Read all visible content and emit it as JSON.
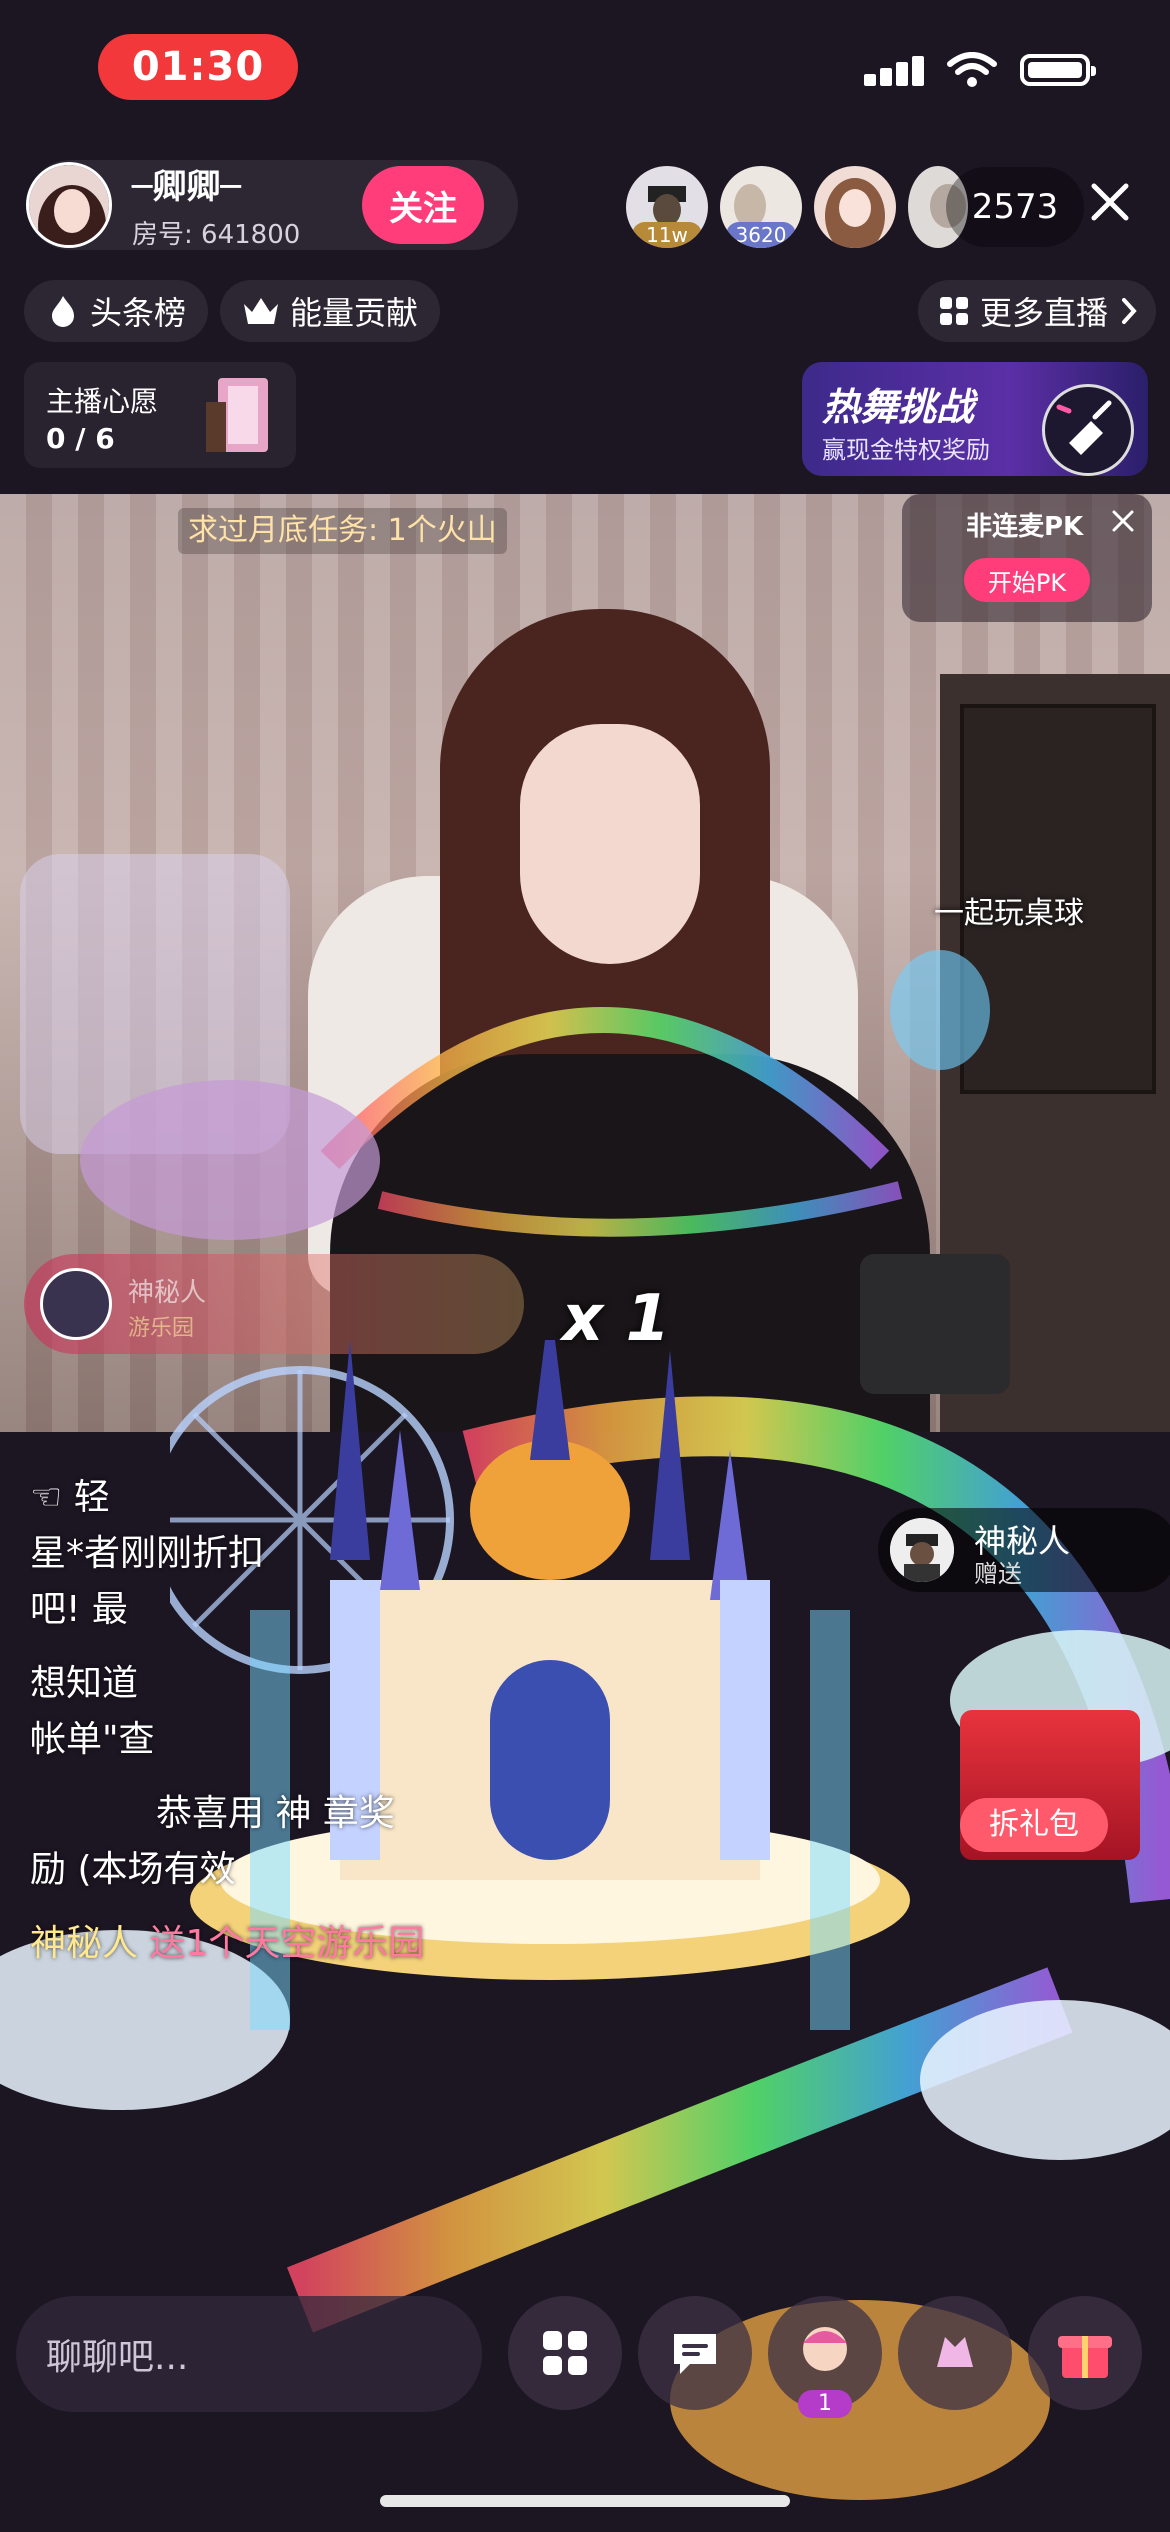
{
  "status_bar": {
    "time": "01:30"
  },
  "host": {
    "name": "─卿卿─",
    "room_label": "房号: 641800",
    "follow_label": "关注"
  },
  "viewers": {
    "top": [
      {
        "badge": "11w",
        "badge_color": "#b78a3a"
      },
      {
        "badge": "3620",
        "badge_color": "#6a76c9"
      },
      {
        "badge": "",
        "badge_color": ""
      },
      {
        "badge": "",
        "badge_color": ""
      }
    ],
    "count": "2573"
  },
  "rank_row": {
    "headline": "头条榜",
    "energy": "能量贡献",
    "more_live": "更多直播"
  },
  "wish": {
    "title": "主播心愿",
    "progress": "0 / 6"
  },
  "challenge": {
    "title": "热舞挑战",
    "subtitle": "赢现金特权奖励"
  },
  "stream": {
    "task": "求过月底任务: 1个火山",
    "billiards": "一起玩桌球",
    "pk_title": "非连麦PK",
    "pk_button": "开始PK"
  },
  "gift_effect": {
    "sender_faded": "神秘人",
    "gift_faded": "游乐园",
    "multiplier": "x 1"
  },
  "sender_chip": {
    "name": "神秘人",
    "action": "赠送"
  },
  "chat": {
    "lines": [
      {
        "text": "☜ 轻"
      },
      {
        "text": "星*者刚刚折扣"
      },
      {
        "text": "吧! 最"
      },
      {
        "text": "想知道"
      },
      {
        "text": "帐单\"查"
      },
      {
        "text": "恭喜用 神 章奖"
      },
      {
        "text": "励 (本场有效"
      }
    ],
    "gift_line": {
      "user": "神秘人",
      "text": "送1个天空游乐园"
    }
  },
  "promo": {
    "label": "拆礼包"
  },
  "bottom_bar": {
    "input_placeholder": "聊聊吧...",
    "friend_count": "1"
  },
  "colors": {
    "accent_pink": "#ff3d7b",
    "time_pill": "#f2383b",
    "background": "#1c1522"
  }
}
